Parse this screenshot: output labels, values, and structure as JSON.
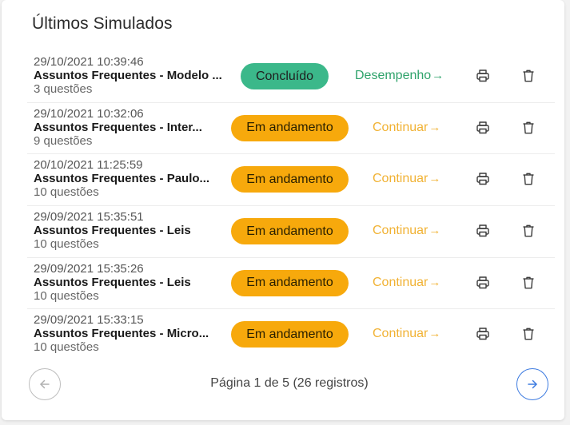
{
  "header": {
    "title": "Últimos Simulados"
  },
  "rows": [
    {
      "date": "29/10/2021 10:39:46",
      "name": "Assuntos Frequentes - Modelo ...",
      "count": "3 questões",
      "status": "Concluído",
      "status_kind": "done",
      "action": "Desempenho",
      "action_kind": "perf"
    },
    {
      "date": "29/10/2021 10:32:06",
      "name": "Assuntos Frequentes - Inter...",
      "count": "9 questões",
      "status": "Em andamento",
      "status_kind": "progress",
      "action": "Continuar",
      "action_kind": "cont"
    },
    {
      "date": "20/10/2021 11:25:59",
      "name": "Assuntos Frequentes - Paulo...",
      "count": "10 questões",
      "status": "Em andamento",
      "status_kind": "progress",
      "action": "Continuar",
      "action_kind": "cont"
    },
    {
      "date": "29/09/2021 15:35:51",
      "name": "Assuntos Frequentes - Leis",
      "count": "10 questões",
      "status": "Em andamento",
      "status_kind": "progress",
      "action": "Continuar",
      "action_kind": "cont"
    },
    {
      "date": "29/09/2021 15:35:26",
      "name": "Assuntos Frequentes - Leis",
      "count": "10 questões",
      "status": "Em andamento",
      "status_kind": "progress",
      "action": "Continuar",
      "action_kind": "cont"
    },
    {
      "date": "29/09/2021 15:33:15",
      "name": "Assuntos Frequentes - Micro...",
      "count": "10 questões",
      "status": "Em andamento",
      "status_kind": "progress",
      "action": "Continuar",
      "action_kind": "cont"
    }
  ],
  "icons": {
    "print": "printer-icon",
    "delete": "trash-icon",
    "prev": "arrow-left-icon",
    "next": "arrow-right-icon",
    "action_arrow": "arrow-right-icon"
  },
  "pagination": {
    "text": "Página 1 de 5 (26 registros)"
  },
  "colors": {
    "done": "#3bb88a",
    "progress": "#f7a90c",
    "performance_link": "#2fa36b",
    "continue_link": "#f1b234",
    "next_button": "#3d7be0"
  }
}
